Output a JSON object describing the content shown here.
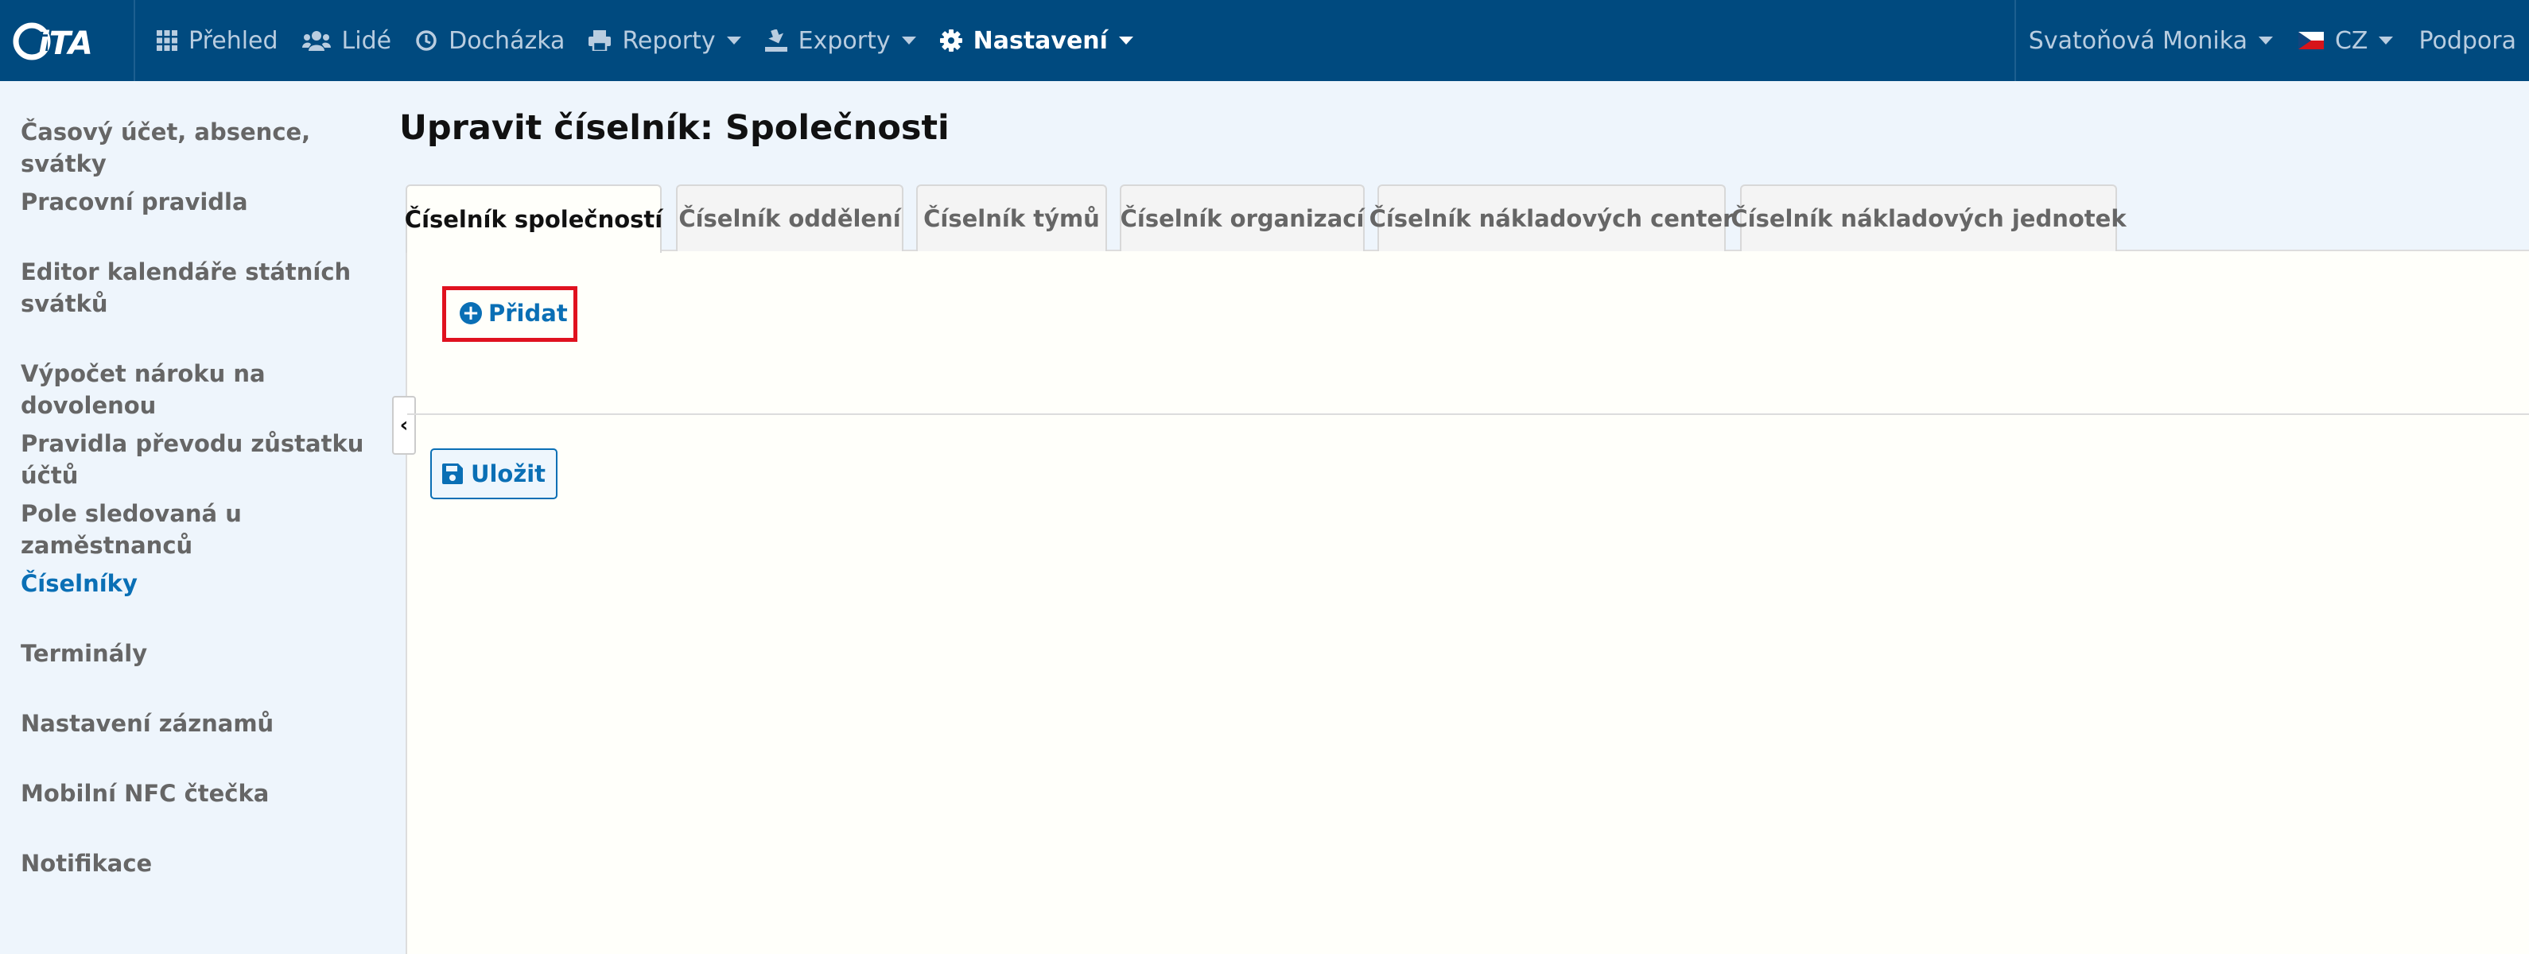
{
  "app": {
    "logo_text": "iTA"
  },
  "nav": {
    "items": [
      {
        "label": "Přehled",
        "icon": "grid-icon"
      },
      {
        "label": "Lidé",
        "icon": "users-icon"
      },
      {
        "label": "Docházka",
        "icon": "clock-icon"
      },
      {
        "label": "Reporty",
        "icon": "print-icon"
      },
      {
        "label": "Exporty",
        "icon": "export-icon"
      },
      {
        "label": "Nastavení",
        "icon": "gear-icon",
        "active": true
      }
    ],
    "user": "Svatoňová Monika",
    "language": "CZ",
    "support": "Podpora"
  },
  "sidebar": {
    "items": [
      {
        "label": "Časový účet, absence, svátky"
      },
      {
        "label": "Pracovní pravidla"
      },
      {
        "label": "Editor kalendáře státních svátků"
      },
      {
        "label": "Výpočet nároku na dovolenou"
      },
      {
        "label": "Pravidla převodu zůstatku účtů"
      },
      {
        "label": "Pole sledovaná u zaměstnanců"
      },
      {
        "label": "Číselníky",
        "active": true
      },
      {
        "label": "Terminály"
      },
      {
        "label": "Nastavení záznamů"
      },
      {
        "label": "Mobilní NFC čtečka"
      },
      {
        "label": "Notifikace"
      }
    ]
  },
  "main": {
    "title": "Upravit číselník: Společnosti",
    "tabs": [
      {
        "label": "Číselník společností",
        "active": true
      },
      {
        "label": "Číselník oddělení"
      },
      {
        "label": "Číselník týmů"
      },
      {
        "label": "Číselník organizací"
      },
      {
        "label": "Číselník nákladových center"
      },
      {
        "label": "Číselník nákladových jednotek"
      }
    ],
    "add_label": "Přidat",
    "save_label": "Uložit"
  },
  "colors": {
    "navbar": "#004a7f",
    "accent": "#0a6fb5",
    "highlight": "#e0121f",
    "background": "#eef5fc"
  }
}
